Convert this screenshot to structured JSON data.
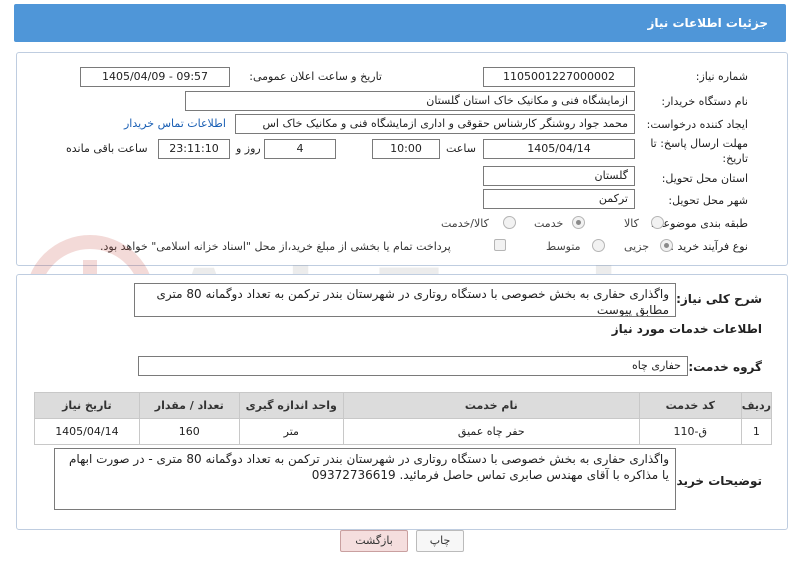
{
  "header": {
    "title": "جزئیات اطلاعات نیاز"
  },
  "watermark": {
    "text": "AriaTender.net"
  },
  "form": {
    "need_number_label": "شماره نیاز:",
    "need_number_value": "1105001227000002",
    "announce_label": "تاریخ و ساعت اعلان عمومی:",
    "announce_value": "1405/04/09 - 09:57",
    "buyer_org_label": "نام دستگاه خریدار:",
    "buyer_org_value": "ازمایشگاه فنی و مکانیک خاک استان گلستان",
    "creator_label": "ایجاد کننده درخواست:",
    "creator_value": "محمد جواد روشنگر کارشناس حقوقی و اداری ازمایشگاه فنی و مکانیک خاک اس",
    "buyer_contact_link": "اطلاعات تماس خریدار",
    "deadline_label": "مهلت ارسال پاسخ: تا تاریخ:",
    "deadline_date": "1405/04/14",
    "time_label": "ساعت",
    "deadline_time": "10:00",
    "days_value": "4",
    "days_label": "روز و",
    "remaining_value": "23:11:10",
    "remaining_label": "ساعت باقی مانده",
    "province_label": "استان محل تحویل:",
    "province_value": "گلستان",
    "city_label": "شهر محل تحویل:",
    "city_value": "ترکمن",
    "category_label": "طبقه بندی موضوعی:",
    "category_options": [
      "کالا",
      "خدمت",
      "کالا/خدمت"
    ],
    "category_selected": "خدمت",
    "purchase_type_label": "نوع فرآیند خرید :",
    "purchase_type_options": [
      "جزیی",
      "متوسط"
    ],
    "purchase_type_selected": "جزیی",
    "payment_note": "پرداخت تمام یا بخشی از مبلغ خرید،از محل \"اسناد خزانه اسلامی\" خواهد بود."
  },
  "summary": {
    "label": "شرح کلی نیاز:",
    "value": "واگذاری حفاری به بخش خصوصی با دستگاه روتاری در شهرستان بندر ترکمن به تعداد دوگمانه 80 متری مطابق پیوست"
  },
  "services": {
    "section_title": "اطلاعات خدمات مورد نیاز",
    "group_label": "گروه خدمت:",
    "group_value": "حفاری چاه",
    "columns": [
      "ردیف",
      "کد خدمت",
      "نام خدمت",
      "واحد اندازه گیری",
      "تعداد / مقدار",
      "تاریخ نیاز"
    ],
    "rows": [
      {
        "row": "1",
        "code": "ق-110",
        "name": "حفر چاه عمیق",
        "unit": "متر",
        "qty": "160",
        "date": "1405/04/14"
      }
    ]
  },
  "buyer_notes": {
    "label": "توضیحات خریدار:",
    "value": "واگذاری حفاری به بخش خصوصی با دستگاه روتاری در شهرستان بندر ترکمن به تعداد دوگمانه 80 متری - در صورت ابهام یا مذاکره با آقای مهندس صابری تماس حاصل فرمائید. 09372736619"
  },
  "buttons": {
    "print": "چاپ",
    "back": "بازگشت"
  }
}
